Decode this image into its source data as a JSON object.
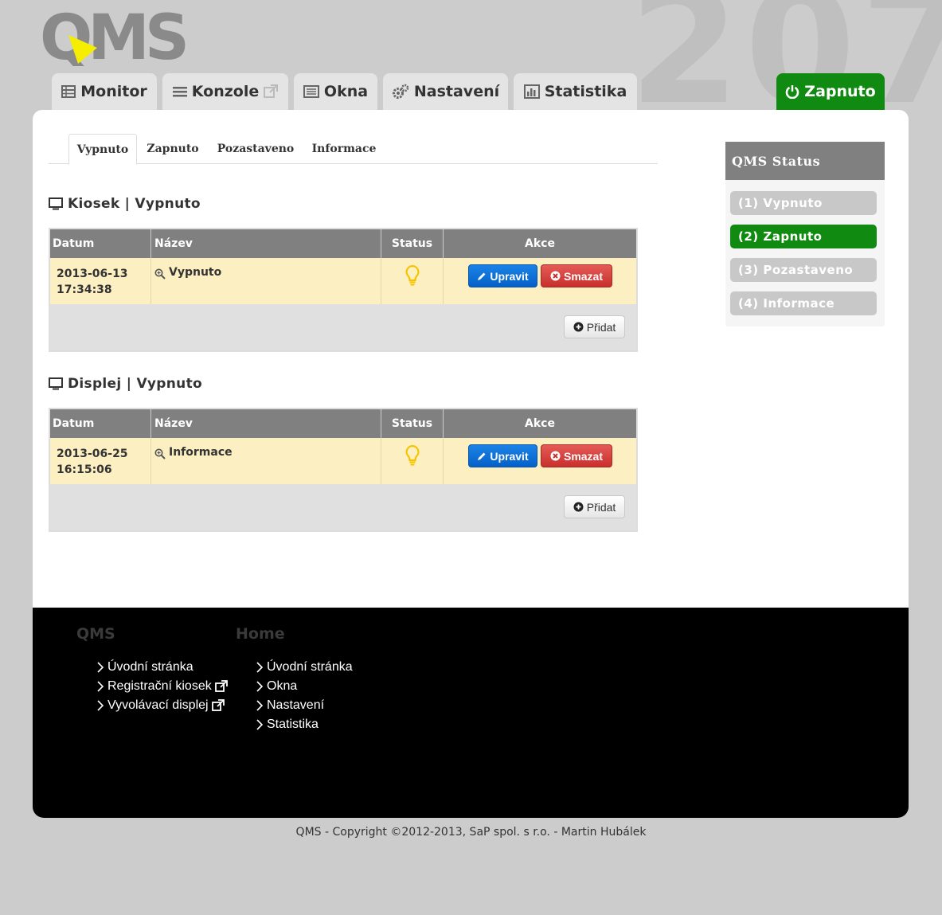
{
  "header": {
    "logo_text": "QMS",
    "big_number": "207",
    "nav": [
      {
        "label": "Monitor",
        "icon": "table-icon"
      },
      {
        "label": "Konzole",
        "icon": "list-icon"
      },
      {
        "label": "Okna",
        "icon": "window-list-icon"
      },
      {
        "label": "Nastavení",
        "icon": "cogs-icon"
      },
      {
        "label": "Statistika",
        "icon": "bar-chart-icon"
      }
    ],
    "power_label": "Zapnuto"
  },
  "subtabs": [
    "Vypnuto",
    "Zapnuto",
    "Pozastaveno",
    "Informace"
  ],
  "table_headers": {
    "datum": "Datum",
    "nazev": "Název",
    "status": "Status",
    "akce": "Akce"
  },
  "buttons": {
    "edit": "Upravit",
    "delete": "Smazat",
    "add": "Přidat"
  },
  "sections": [
    {
      "title": "Kiosek | Vypnuto",
      "date": "2013-06-13",
      "time": "17:34:38",
      "name": "Vypnuto"
    },
    {
      "title": "Displej | Vypnuto",
      "date": "2013-06-25",
      "time": "16:15:06",
      "name": "Informace"
    }
  ],
  "sidebar": {
    "title": "QMS Status",
    "items": [
      "(1) Vypnuto",
      "(2) Zapnuto",
      "(3) Pozastaveno",
      "(4) Informace"
    ],
    "active_index": 1
  },
  "footer": {
    "col1_title": "QMS",
    "col1_links": [
      "Úvodní stránka",
      "Registrační kiosek",
      "Vyvolávací displej"
    ],
    "col2_title": "Home",
    "col2_links": [
      "Úvodní stránka",
      "Okna",
      "Nastavení",
      "Statistika"
    ]
  },
  "copyright": "QMS - Copyright ©2012-2013, SaP spol. s r.o. - Martin Hubálek",
  "colors": {
    "accent_green": "#108a10",
    "logo_yellow": "#f5ee00",
    "row_bg": "#fcefc2",
    "header_gray": "#808080"
  }
}
